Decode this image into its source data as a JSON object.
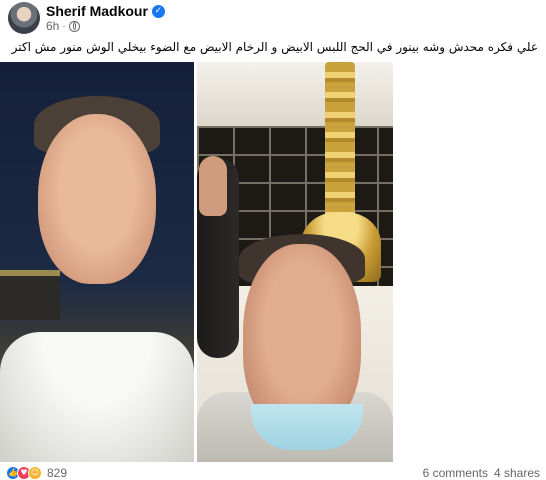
{
  "post": {
    "author": "Sherif Madkour",
    "time": "6h",
    "time_separator": "·",
    "caption": "علي فكره محدش وشه بينور في الحج اللبس الابيض و الرخام الابيض مع الضوء بيخلي الوش منور مش اكتر"
  },
  "photos": [
    {
      "description": "selfie at night wearing white ihram robe"
    },
    {
      "description": "selfie near gold pillar wearing face mask"
    }
  ],
  "footer": {
    "reaction_count": "829",
    "comments": "6 comments",
    "shares": "4 shares"
  },
  "icons": {
    "verified": "verified-badge-icon",
    "audience": "globe-icon",
    "reactions": [
      "like-icon",
      "love-icon",
      "haha-icon"
    ]
  },
  "colors": {
    "accent": "#1877f2",
    "secondary_text": "#65676b"
  }
}
